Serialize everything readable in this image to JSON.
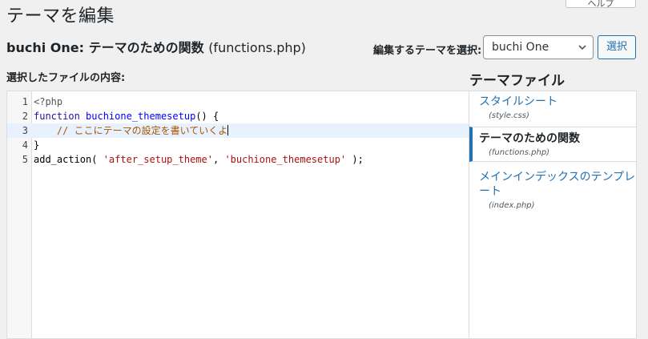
{
  "page": {
    "title": "テーマを編集",
    "help_label": "ヘルプ"
  },
  "heading": {
    "theme_name": "buchi One:",
    "file_desc": "テーマのための関数",
    "file_name": "(functions.php)"
  },
  "theme_selector": {
    "label": "編集するテーマを選択:",
    "value": "buchi One",
    "button_label": "選択"
  },
  "editor": {
    "label": "選択したファイルの内容:",
    "lines": [
      {
        "num": "1",
        "tokens": [
          {
            "t": "<?php",
            "c": "meta"
          }
        ]
      },
      {
        "num": "2",
        "tokens": [
          {
            "t": "function",
            "c": "kw"
          },
          {
            "t": " ",
            "c": "plain"
          },
          {
            "t": "buchione_themesetup",
            "c": "def"
          },
          {
            "t": "() {",
            "c": "plain"
          }
        ]
      },
      {
        "num": "3",
        "tokens": [
          {
            "t": "    ",
            "c": "plain"
          },
          {
            "t": "// ここにテーマの設定を書いていくよ",
            "c": "comment"
          }
        ],
        "active": true
      },
      {
        "num": "4",
        "tokens": [
          {
            "t": "}",
            "c": "plain"
          }
        ]
      },
      {
        "num": "5",
        "tokens": [
          {
            "t": "add_action( ",
            "c": "plain"
          },
          {
            "t": "'after_setup_theme'",
            "c": "str"
          },
          {
            "t": ", ",
            "c": "plain"
          },
          {
            "t": "'buchione_themesetup'",
            "c": "str"
          },
          {
            "t": " );",
            "c": "plain"
          }
        ]
      }
    ]
  },
  "theme_files": {
    "heading": "テーマファイル",
    "items": [
      {
        "name": "スタイルシート",
        "path": "(style.css)",
        "current": false
      },
      {
        "name": "テーマのための関数",
        "path": "(functions.php)",
        "current": true
      },
      {
        "name": "メインインデックスのテンプレート",
        "path": "(index.php)",
        "current": false
      }
    ]
  },
  "colors": {
    "accent": "#2271b1",
    "active_line": "#e8f2ff",
    "background": "#f0f0f1"
  },
  "icons": {
    "select_chevron": "chevron-down-icon"
  }
}
